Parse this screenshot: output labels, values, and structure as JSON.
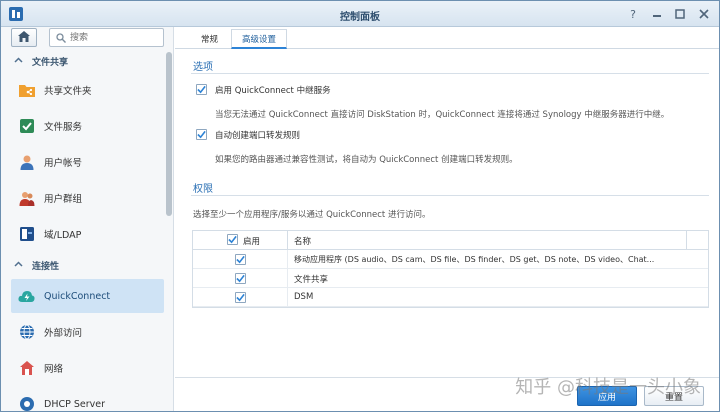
{
  "window": {
    "title": "控制面板"
  },
  "sidebar": {
    "search_placeholder": "搜索",
    "sections": [
      {
        "label": "文件共享"
      },
      {
        "label": "连接性"
      }
    ],
    "items": [
      {
        "label": "共享文件夹",
        "icon": "shared-folder-icon"
      },
      {
        "label": "文件服务",
        "icon": "file-services-icon"
      },
      {
        "label": "用户帐号",
        "icon": "user-icon"
      },
      {
        "label": "用户群组",
        "icon": "group-icon"
      },
      {
        "label": "域/LDAP",
        "icon": "domain-ldap-icon"
      },
      {
        "label": "QuickConnect",
        "icon": "quickconnect-icon",
        "active": true
      },
      {
        "label": "外部访问",
        "icon": "external-access-icon"
      },
      {
        "label": "网络",
        "icon": "network-icon"
      },
      {
        "label": "DHCP Server",
        "icon": "dhcp-server-icon"
      }
    ]
  },
  "tabs": [
    {
      "label": "常规"
    },
    {
      "label": "高级设置",
      "active": true
    }
  ],
  "options": {
    "title": "选项",
    "relay": {
      "label": "启用 QuickConnect 中继服务",
      "checked": true,
      "description": "当您无法通过 QuickConnect 直接访问 DiskStation 时，QuickConnect 连接将通过 Synology 中继服务器进行中继。"
    },
    "port_forward": {
      "label": "自动创建端口转发规则",
      "checked": true,
      "description": "如果您的路由器通过兼容性测试，将自动为 QuickConnect 创建端口转发规则。"
    }
  },
  "permissions": {
    "title": "权限",
    "description": "选择至少一个应用程序/服务以通过 QuickConnect 进行访问。",
    "columns": {
      "enable": "启用",
      "name": "名称"
    },
    "rows": [
      {
        "name": "移动应用程序 (DS audio、DS cam、DS file、DS finder、DS get、DS note、DS video、Chat...",
        "enabled": true
      },
      {
        "name": "文件共享",
        "enabled": true
      },
      {
        "name": "DSM",
        "enabled": true
      }
    ]
  },
  "footer": {
    "apply_label": "应用",
    "reset_label": "重置"
  },
  "watermark": "知乎 @科技是一头小象",
  "colors": {
    "accent": "#2d83d6",
    "active_nav": "#cfe3f5",
    "section_title": "#2a6fb4"
  }
}
